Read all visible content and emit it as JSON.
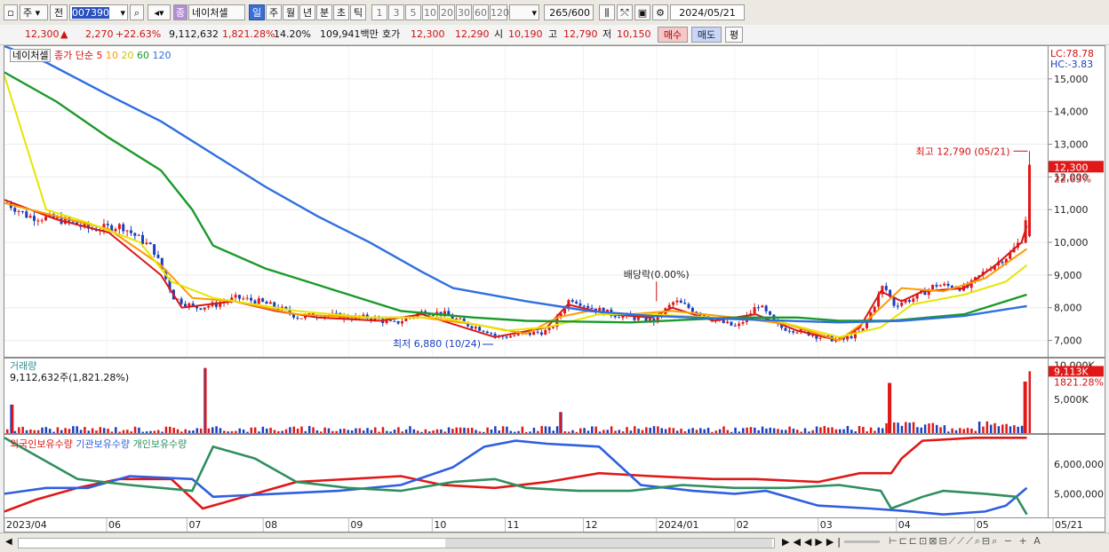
{
  "toolbar": {
    "market": "주",
    "prev": "전",
    "code": "007390",
    "badge": "종",
    "name": "네이처셀",
    "periods": [
      "일",
      "주",
      "월",
      "년",
      "분",
      "초",
      "틱"
    ],
    "intervals": [
      "1",
      "3",
      "5",
      "10",
      "20",
      "30",
      "60",
      "120"
    ],
    "count": "265",
    "max": "/600",
    "date": "2024/05/21"
  },
  "quote": {
    "price": "12,300",
    "change_arrow": "▲",
    "change": "2,270",
    "change_pct": "+22.63%",
    "volume": "9,112,632",
    "volume_pct": "1,821.28%",
    "turnover": "14.20%",
    "amount": "109,941백만",
    "bid_label": "호가",
    "ask": "12,300",
    "bid": "12,290",
    "open_label": "시",
    "open": "10,190",
    "high_label": "고",
    "high": "12,790",
    "low_label": "저",
    "low": "10,150",
    "buy": "매수",
    "sell": "매도",
    "eval": "평"
  },
  "legend": {
    "name": "네이처셀",
    "ma_label": "종가 단순",
    "ma": [
      {
        "label": "5",
        "color": "#d81818"
      },
      {
        "label": "10",
        "color": "#ff9a00"
      },
      {
        "label": "20",
        "color": "#e6e600"
      },
      {
        "label": "60",
        "color": "#1a9a2a"
      },
      {
        "label": "120",
        "color": "#2f6fe0"
      }
    ]
  },
  "lchc": {
    "lc": "LC:78.78",
    "hc": "HC:-3.83"
  },
  "annotations": {
    "high": "최고 12,790 (05/21)",
    "low": "최저 6,880 (10/24)",
    "dividend": "배당락(0.00%)"
  },
  "price_tag": {
    "value": "12,300",
    "pct": "22.63%"
  },
  "volume_panel": {
    "title": "거래량",
    "sub": "9,112,632주(1,821.28%)",
    "tag": "9,113K",
    "tag_pct": "1821.28%",
    "ticks": [
      "10,000K",
      "5,000K"
    ]
  },
  "holding_panel": {
    "series": [
      {
        "label": "외국인보유수량",
        "color": "#e01818"
      },
      {
        "label": "기관보유수량",
        "color": "#2f5fe0"
      },
      {
        "label": "개인보유수량",
        "color": "#2f8f5f"
      }
    ],
    "ticks": [
      "6,000,000",
      "5,000,000"
    ]
  },
  "xaxis": {
    "labels": [
      "2023/04",
      "06",
      "07",
      "08",
      "09",
      "10",
      "11",
      "12",
      "2024/01",
      "02",
      "03",
      "04",
      "05",
      "05/21"
    ]
  },
  "chart_data": [
    {
      "type": "candlestick",
      "title": "네이처셀",
      "ylim": [
        6500,
        16000
      ],
      "yticks": [
        7000,
        8000,
        9000,
        10000,
        11000,
        12000,
        13000,
        14000,
        15000
      ],
      "x": [
        "2023/04",
        "06",
        "07",
        "08",
        "09",
        "10",
        "11",
        "12",
        "2024/01",
        "02",
        "03",
        "04",
        "05",
        "05/21"
      ],
      "close_path": [
        [
          0,
          11200
        ],
        [
          0.02,
          10800
        ],
        [
          0.05,
          10700
        ],
        [
          0.08,
          10400
        ],
        [
          0.11,
          10500
        ],
        [
          0.14,
          9800
        ],
        [
          0.16,
          8300
        ],
        [
          0.18,
          8000
        ],
        [
          0.2,
          8100
        ],
        [
          0.22,
          8300
        ],
        [
          0.24,
          8200
        ],
        [
          0.26,
          8000
        ],
        [
          0.28,
          7700
        ],
        [
          0.3,
          7800
        ],
        [
          0.33,
          7700
        ],
        [
          0.35,
          7700
        ],
        [
          0.37,
          7500
        ],
        [
          0.4,
          7900
        ],
        [
          0.42,
          7800
        ],
        [
          0.44,
          7500
        ],
        [
          0.46,
          7300
        ],
        [
          0.47,
          7100
        ],
        [
          0.5,
          7200
        ],
        [
          0.52,
          7300
        ],
        [
          0.54,
          8300
        ],
        [
          0.56,
          8000
        ],
        [
          0.58,
          7800
        ],
        [
          0.6,
          7700
        ],
        [
          0.62,
          7600
        ],
        [
          0.64,
          8200
        ],
        [
          0.66,
          7900
        ],
        [
          0.68,
          7600
        ],
        [
          0.7,
          7400
        ],
        [
          0.72,
          8100
        ],
        [
          0.74,
          7400
        ],
        [
          0.76,
          7300
        ],
        [
          0.78,
          7100
        ],
        [
          0.8,
          7000
        ],
        [
          0.82,
          7300
        ],
        [
          0.84,
          8700
        ],
        [
          0.85,
          8100
        ],
        [
          0.87,
          8300
        ],
        [
          0.89,
          8700
        ],
        [
          0.92,
          8600
        ],
        [
          0.94,
          9200
        ],
        [
          0.96,
          9600
        ],
        [
          0.975,
          10200
        ],
        [
          0.98,
          12300
        ]
      ],
      "series": [
        {
          "name": "5",
          "values": [
            [
              0,
              11300
            ],
            [
              0.05,
              10700
            ],
            [
              0.1,
              10300
            ],
            [
              0.15,
              9000
            ],
            [
              0.17,
              8000
            ],
            [
              0.22,
              8200
            ],
            [
              0.26,
              7900
            ],
            [
              0.3,
              7700
            ],
            [
              0.36,
              7600
            ],
            [
              0.4,
              7800
            ],
            [
              0.43,
              7500
            ],
            [
              0.47,
              7100
            ],
            [
              0.52,
              7400
            ],
            [
              0.54,
              8100
            ],
            [
              0.58,
              7800
            ],
            [
              0.62,
              7700
            ],
            [
              0.64,
              8000
            ],
            [
              0.68,
              7600
            ],
            [
              0.72,
              7800
            ],
            [
              0.76,
              7300
            ],
            [
              0.8,
              7000
            ],
            [
              0.82,
              7400
            ],
            [
              0.84,
              8500
            ],
            [
              0.86,
              8200
            ],
            [
              0.88,
              8500
            ],
            [
              0.92,
              8600
            ],
            [
              0.95,
              9300
            ],
            [
              0.975,
              10000
            ],
            [
              0.98,
              10500
            ]
          ]
        },
        {
          "name": "10",
          "values": [
            [
              0,
              11200
            ],
            [
              0.05,
              10800
            ],
            [
              0.1,
              10400
            ],
            [
              0.15,
              9300
            ],
            [
              0.18,
              8300
            ],
            [
              0.22,
              8200
            ],
            [
              0.28,
              7800
            ],
            [
              0.34,
              7700
            ],
            [
              0.4,
              7700
            ],
            [
              0.45,
              7500
            ],
            [
              0.5,
              7200
            ],
            [
              0.53,
              7700
            ],
            [
              0.56,
              7900
            ],
            [
              0.6,
              7800
            ],
            [
              0.64,
              7900
            ],
            [
              0.7,
              7700
            ],
            [
              0.75,
              7500
            ],
            [
              0.8,
              7000
            ],
            [
              0.83,
              7700
            ],
            [
              0.86,
              8600
            ],
            [
              0.9,
              8500
            ],
            [
              0.94,
              8900
            ],
            [
              0.98,
              9800
            ]
          ]
        },
        {
          "name": "20",
          "values": [
            [
              0,
              15100
            ],
            [
              0.04,
              11000
            ],
            [
              0.08,
              10600
            ],
            [
              0.13,
              10000
            ],
            [
              0.16,
              8800
            ],
            [
              0.2,
              8300
            ],
            [
              0.28,
              7900
            ],
            [
              0.35,
              7700
            ],
            [
              0.42,
              7700
            ],
            [
              0.48,
              7300
            ],
            [
              0.52,
              7400
            ],
            [
              0.57,
              7800
            ],
            [
              0.62,
              7800
            ],
            [
              0.68,
              7700
            ],
            [
              0.74,
              7600
            ],
            [
              0.8,
              7100
            ],
            [
              0.84,
              7400
            ],
            [
              0.87,
              8100
            ],
            [
              0.92,
              8400
            ],
            [
              0.96,
              8800
            ],
            [
              0.98,
              9300
            ]
          ]
        },
        {
          "name": "60",
          "values": [
            [
              0,
              15200
            ],
            [
              0.05,
              14300
            ],
            [
              0.1,
              13200
            ],
            [
              0.15,
              12200
            ],
            [
              0.18,
              11000
            ],
            [
              0.2,
              9900
            ],
            [
              0.25,
              9200
            ],
            [
              0.3,
              8700
            ],
            [
              0.35,
              8200
            ],
            [
              0.38,
              7900
            ],
            [
              0.45,
              7700
            ],
            [
              0.5,
              7600
            ],
            [
              0.6,
              7550
            ],
            [
              0.7,
              7700
            ],
            [
              0.76,
              7700
            ],
            [
              0.8,
              7600
            ],
            [
              0.85,
              7600
            ],
            [
              0.92,
              7800
            ],
            [
              0.98,
              8400
            ]
          ]
        },
        {
          "name": "120",
          "values": [
            [
              0,
              16000
            ],
            [
              0.04,
              15500
            ],
            [
              0.1,
              14500
            ],
            [
              0.15,
              13700
            ],
            [
              0.2,
              12700
            ],
            [
              0.25,
              11700
            ],
            [
              0.3,
              10800
            ],
            [
              0.35,
              10000
            ],
            [
              0.4,
              9100
            ],
            [
              0.43,
              8600
            ],
            [
              0.5,
              8200
            ],
            [
              0.56,
              7900
            ],
            [
              0.62,
              7750
            ],
            [
              0.7,
              7650
            ],
            [
              0.8,
              7550
            ],
            [
              0.86,
              7600
            ],
            [
              0.92,
              7750
            ],
            [
              0.98,
              8050
            ]
          ]
        }
      ]
    },
    {
      "type": "bar",
      "title": "거래량",
      "ylim": [
        0,
        11000
      ],
      "unit": "K",
      "spikes": [
        [
          0.005,
          4200
        ],
        [
          0.19,
          9600
        ],
        [
          0.53,
          3100
        ],
        [
          0.845,
          7400
        ],
        [
          0.975,
          7600
        ],
        [
          0.98,
          9113
        ]
      ]
    },
    {
      "type": "line",
      "title": "보유수량",
      "ylim": [
        4200000,
        7000000
      ],
      "series": [
        {
          "name": "외국인보유수량",
          "values": [
            [
              0,
              4400000
            ],
            [
              0.03,
              4800000
            ],
            [
              0.07,
              5200000
            ],
            [
              0.11,
              5500000
            ],
            [
              0.16,
              5500000
            ],
            [
              0.19,
              4500000
            ],
            [
              0.23,
              4900000
            ],
            [
              0.28,
              5400000
            ],
            [
              0.33,
              5500000
            ],
            [
              0.38,
              5600000
            ],
            [
              0.42,
              5300000
            ],
            [
              0.47,
              5200000
            ],
            [
              0.52,
              5400000
            ],
            [
              0.57,
              5700000
            ],
            [
              0.62,
              5600000
            ],
            [
              0.68,
              5500000
            ],
            [
              0.72,
              5500000
            ],
            [
              0.78,
              5400000
            ],
            [
              0.82,
              5700000
            ],
            [
              0.85,
              5700000
            ],
            [
              0.86,
              6200000
            ],
            [
              0.88,
              6800000
            ],
            [
              0.93,
              6900000
            ],
            [
              0.98,
              6900000
            ]
          ]
        },
        {
          "name": "기관보유수량",
          "values": [
            [
              0,
              5000000
            ],
            [
              0.04,
              5200000
            ],
            [
              0.08,
              5200000
            ],
            [
              0.12,
              5600000
            ],
            [
              0.18,
              5500000
            ],
            [
              0.2,
              4900000
            ],
            [
              0.26,
              5000000
            ],
            [
              0.32,
              5100000
            ],
            [
              0.38,
              5300000
            ],
            [
              0.43,
              5900000
            ],
            [
              0.46,
              6600000
            ],
            [
              0.49,
              6800000
            ],
            [
              0.52,
              6700000
            ],
            [
              0.57,
              6600000
            ],
            [
              0.61,
              5300000
            ],
            [
              0.66,
              5100000
            ],
            [
              0.7,
              5000000
            ],
            [
              0.73,
              5100000
            ],
            [
              0.78,
              4600000
            ],
            [
              0.83,
              4500000
            ],
            [
              0.87,
              4400000
            ],
            [
              0.9,
              4300000
            ],
            [
              0.94,
              4400000
            ],
            [
              0.96,
              4600000
            ],
            [
              0.98,
              5200000
            ]
          ]
        },
        {
          "name": "개인보유수량",
          "values": [
            [
              0,
              6900000
            ],
            [
              0.03,
              6300000
            ],
            [
              0.07,
              5500000
            ],
            [
              0.12,
              5300000
            ],
            [
              0.18,
              5100000
            ],
            [
              0.2,
              6600000
            ],
            [
              0.24,
              6200000
            ],
            [
              0.28,
              5400000
            ],
            [
              0.33,
              5200000
            ],
            [
              0.38,
              5100000
            ],
            [
              0.43,
              5400000
            ],
            [
              0.47,
              5500000
            ],
            [
              0.5,
              5200000
            ],
            [
              0.55,
              5100000
            ],
            [
              0.6,
              5100000
            ],
            [
              0.65,
              5300000
            ],
            [
              0.7,
              5200000
            ],
            [
              0.75,
              5200000
            ],
            [
              0.8,
              5300000
            ],
            [
              0.84,
              5100000
            ],
            [
              0.85,
              4500000
            ],
            [
              0.88,
              4900000
            ],
            [
              0.9,
              5100000
            ],
            [
              0.94,
              5000000
            ],
            [
              0.97,
              4900000
            ],
            [
              0.98,
              4300000
            ]
          ]
        }
      ]
    }
  ]
}
